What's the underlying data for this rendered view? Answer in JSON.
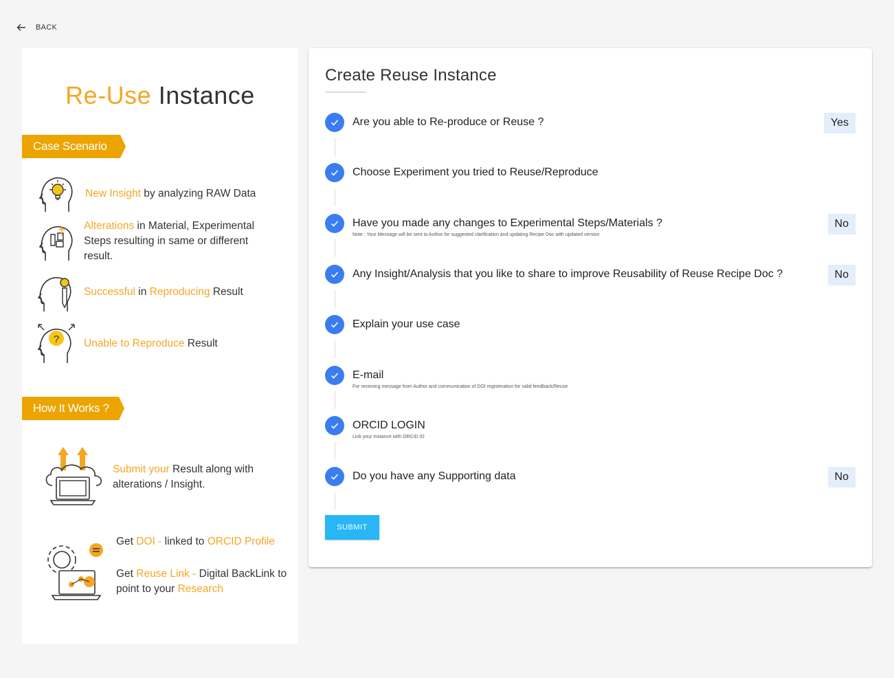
{
  "nav": {
    "back_label": "BACK"
  },
  "infographic": {
    "title_part1": "Re-Use",
    "title_part2": "Instance",
    "case_scenario": {
      "heading": "Case Scenario",
      "items": [
        {
          "highlight": "New Insight",
          "rest": " by analyzing RAW Data"
        },
        {
          "highlight": "Alterations",
          "rest": " in Material, Experimental Steps resulting in same or different result."
        },
        {
          "h1": "Successful",
          "mid": " in ",
          "h2": "Reproducing",
          "end": " Result"
        },
        {
          "highlight": "Unable to Reproduce",
          "rest": " Result"
        }
      ]
    },
    "how_it_works": {
      "heading": "How It Works ?",
      "submit": {
        "highlight": "Submit your",
        "rest": " Result along with alterations / Insight."
      },
      "doi": {
        "p1": "Get ",
        "h1": "DOI -",
        "p2": " linked to ",
        "h2": "ORCID Profile"
      },
      "link": {
        "p1": "Get ",
        "h1": "Reuse Link -",
        "p2": " Digital BackLink to point to your ",
        "h2": "Research"
      }
    }
  },
  "form": {
    "title": "Create Reuse Instance",
    "steps": [
      {
        "label": "Are you able to Re-produce or Reuse ?",
        "answer": "Yes",
        "sub": ""
      },
      {
        "label": "Choose Experiment you tried to Reuse/Reproduce",
        "answer": "",
        "sub": ""
      },
      {
        "label": "Have you made any changes to Experimental Steps/Materials ?",
        "answer": "No",
        "sub": "Note : Your Message will be sent to Author for suggested clarification and updating Recipe Doc with updated version"
      },
      {
        "label": "Any Insight/Analysis that you like to share to improve Reusability of Reuse Recipe Doc ?",
        "answer": "No",
        "sub": ""
      },
      {
        "label": "Explain your use case",
        "answer": "",
        "sub": ""
      },
      {
        "label": "E-mail",
        "answer": "",
        "sub": "For receiving message from Author and communication of DOI registeration for valid feedback/Reuse"
      },
      {
        "label": "ORCID LOGIN",
        "answer": "",
        "sub": "Link your Instance with ORCID ID"
      },
      {
        "label": "Do you have any Supporting data",
        "answer": "No",
        "sub": ""
      }
    ],
    "submit_label": "SUBMIT"
  },
  "colors": {
    "accent_orange": "#f5a623",
    "ribbon": "#eca400",
    "step_blue": "#3b7df0",
    "submit": "#29b6f6",
    "answer_bg": "#e3eefa"
  }
}
